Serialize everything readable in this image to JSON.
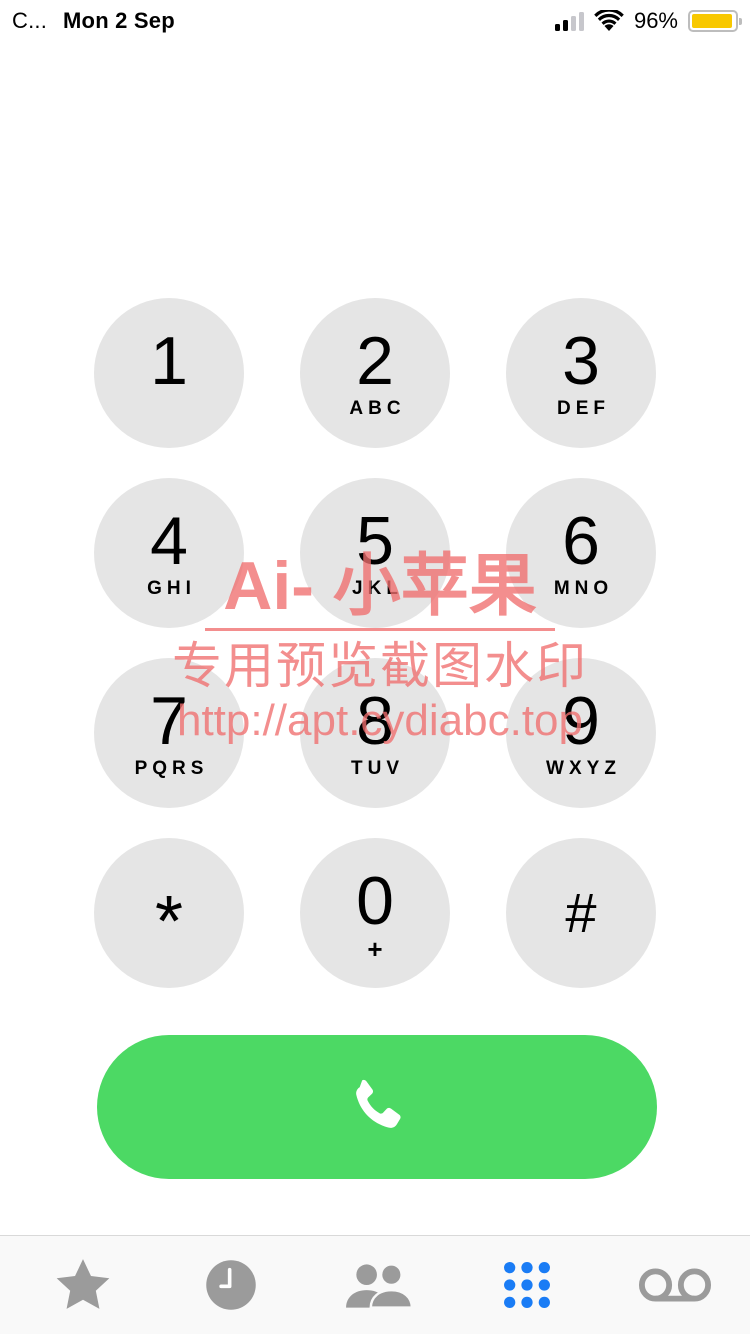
{
  "status_bar": {
    "carrier": "C...",
    "date": "Mon 2 Sep",
    "battery_percent_text": "96%",
    "battery_level": 0.96,
    "battery_color": "#f8c800"
  },
  "keypad": {
    "keys": [
      {
        "digit": "1",
        "letters": ""
      },
      {
        "digit": "2",
        "letters": "ABC"
      },
      {
        "digit": "3",
        "letters": "DEF"
      },
      {
        "digit": "4",
        "letters": "GHI"
      },
      {
        "digit": "5",
        "letters": "JKL"
      },
      {
        "digit": "6",
        "letters": "MNO"
      },
      {
        "digit": "7",
        "letters": "PQRS"
      },
      {
        "digit": "8",
        "letters": "TUV"
      },
      {
        "digit": "9",
        "letters": "WXYZ"
      },
      {
        "digit": "*",
        "letters": ""
      },
      {
        "digit": "0",
        "letters": "+"
      },
      {
        "digit": "#",
        "letters": ""
      }
    ],
    "key_color": "#e5e5e5"
  },
  "call_button": {
    "icon": "phone-icon",
    "color": "#4cd964"
  },
  "watermark": {
    "line1": "Ai- 小苹果",
    "line2": "专用预览截图水印",
    "line3": "http://apt.cydiabc.top"
  },
  "tab_bar": {
    "tabs": [
      {
        "icon": "star-icon",
        "active": false
      },
      {
        "icon": "clock-icon",
        "active": false
      },
      {
        "icon": "contacts-icon",
        "active": false
      },
      {
        "icon": "keypad-icon",
        "active": true
      },
      {
        "icon": "voicemail-icon",
        "active": false
      }
    ],
    "active_color": "#1a7cf5",
    "inactive_color": "#9b9b9b"
  }
}
